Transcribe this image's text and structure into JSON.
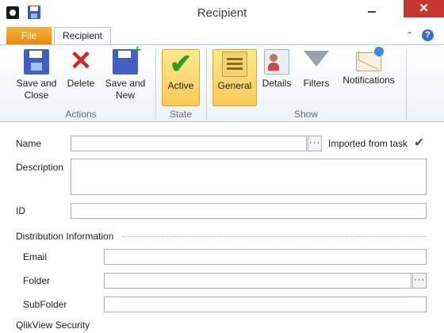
{
  "window": {
    "title": "Recipient"
  },
  "tabs": {
    "file": "File",
    "recipient": "Recipient"
  },
  "ribbon": {
    "actions": {
      "save_close": "Save and Close",
      "delete": "Delete",
      "save_new": "Save and New",
      "group_label": "Actions"
    },
    "state": {
      "active": "Active",
      "group_label": "State"
    },
    "show": {
      "general": "General",
      "details": "Details",
      "filters": "Filters",
      "notifications": "Notifications",
      "group_label": "Show"
    }
  },
  "form": {
    "name_label": "Name",
    "name_value": "",
    "imported_label": "Imported from task",
    "description_label": "Description",
    "description_value": "",
    "id_label": "ID",
    "id_value": "",
    "distribution_section": "Distribution Information",
    "email_label": "Email",
    "email_value": "",
    "folder_label": "Folder",
    "folder_value": "",
    "subfolder_label": "SubFolder",
    "subfolder_value": "",
    "security_section": "QlikView Security",
    "ellipsis": "···"
  },
  "colors": {
    "file_tab": "#f39c12",
    "close_button": "#c7372f",
    "active_highlight": "#f7c957"
  }
}
